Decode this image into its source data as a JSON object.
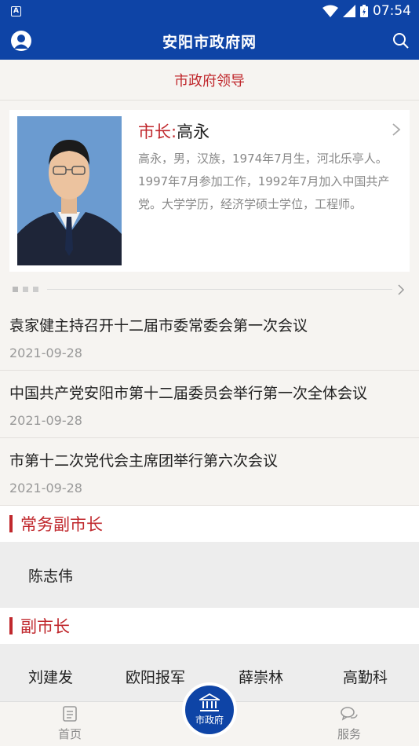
{
  "status_bar": {
    "time": "07:54",
    "app_badge": "A"
  },
  "header": {
    "title": "安阳市政府网"
  },
  "section": {
    "title": "市政府领导"
  },
  "leader": {
    "role": "市长:",
    "name": "高永",
    "bio": "高永，男，汉族，1974年7月生，河北乐亭人。1997年7月参加工作，1992年7月加入中国共产党。大学学历，经济学硕士学位，工程师。"
  },
  "news": [
    {
      "title": "袁家健主持召开十二届市委常委会第一次会议",
      "date": "2021-09-28"
    },
    {
      "title": "中国共产党安阳市第十二届委员会举行第一次全体会议",
      "date": "2021-09-28"
    },
    {
      "title": "市第十二次党代会主席团举行第六次会议",
      "date": "2021-09-28"
    }
  ],
  "executive_vice_mayor": {
    "heading": "常务副市长",
    "names": [
      "陈志伟"
    ]
  },
  "vice_mayors": {
    "heading": "副市长",
    "names": [
      "刘建发",
      "欧阳报军",
      "薛崇林",
      "高勤科"
    ]
  },
  "tabbar": {
    "home": "首页",
    "center": "市政府",
    "service": "服务"
  },
  "colors": {
    "primary": "#0e44a6",
    "accent": "#c0282d",
    "background": "#f6f4f1"
  }
}
